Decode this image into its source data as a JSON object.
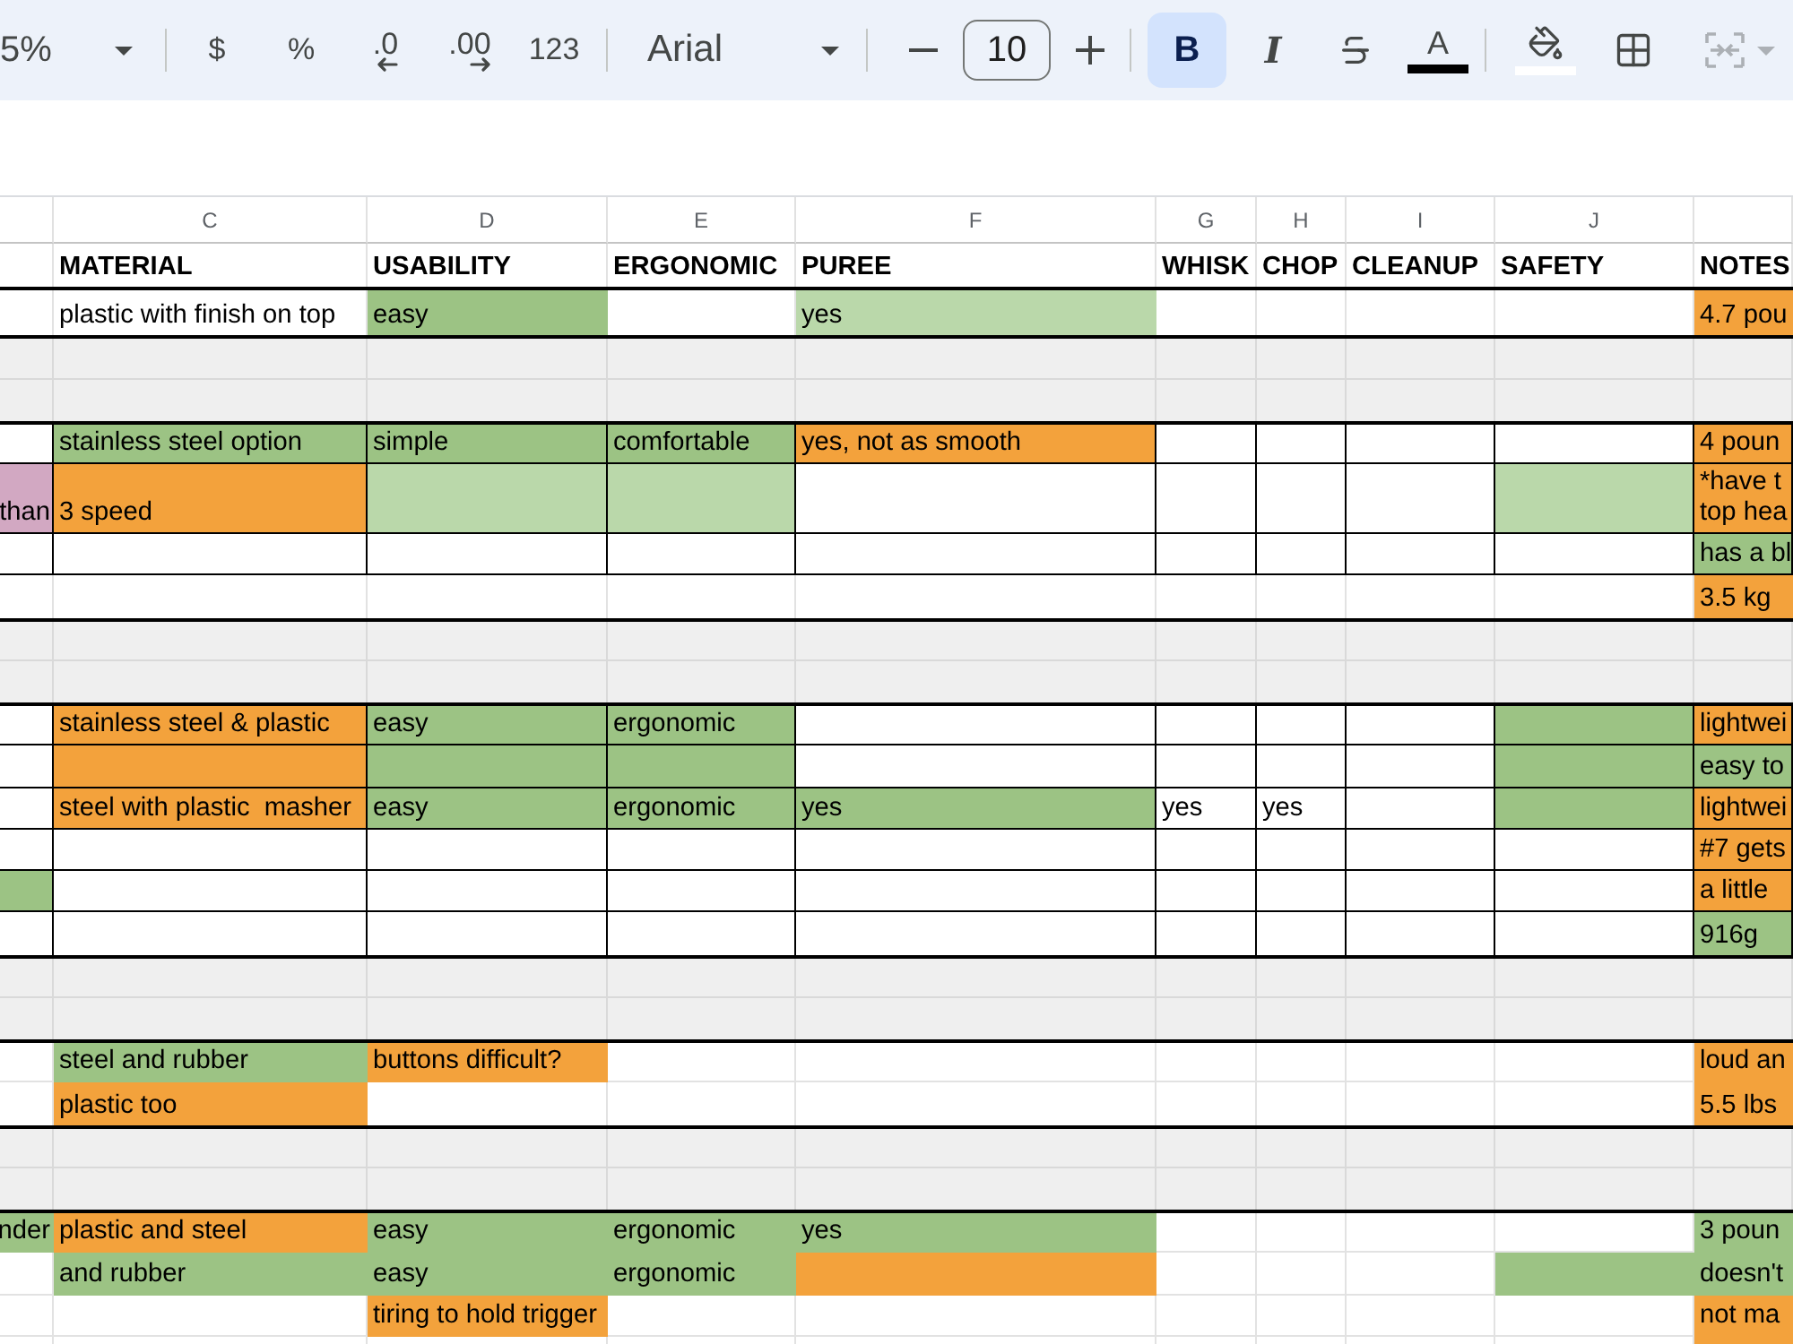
{
  "toolbar": {
    "groups": [
      [
        {
          "kind": "zoom",
          "label": "5%",
          "disabled": false
        }
      ],
      [
        {
          "kind": "text",
          "label": "$",
          "disabled": false
        },
        {
          "kind": "text",
          "label": "%",
          "disabled": false
        },
        {
          "kind": "decrease",
          "label": ".0",
          "disabled": false
        },
        {
          "kind": "increase",
          "label": ".00",
          "disabled": false
        },
        {
          "kind": "text",
          "label": "123",
          "disabled": false
        }
      ],
      [
        {
          "kind": "font",
          "label": "Arial",
          "disabled": false
        }
      ],
      [
        {
          "kind": "minus",
          "disabled": false
        },
        {
          "kind": "size",
          "value": "10",
          "disabled": false
        },
        {
          "kind": "plus",
          "disabled": false
        }
      ],
      [
        {
          "kind": "bold",
          "label": "B",
          "on": true,
          "disabled": false
        },
        {
          "kind": "italic",
          "label": "I",
          "on": false,
          "disabled": false
        },
        {
          "kind": "strike",
          "on": false,
          "disabled": false
        },
        {
          "kind": "textcolor",
          "label": "A",
          "color": "#000000",
          "disabled": false
        }
      ],
      [
        {
          "kind": "fill",
          "color": "#ffffff",
          "disabled": false
        },
        {
          "kind": "borders",
          "disabled": false
        },
        {
          "kind": "merge",
          "disabled": true
        }
      ]
    ]
  },
  "sheet": {
    "column_letters": [
      "C",
      "D",
      "E",
      "F",
      "G",
      "H",
      "I",
      "J"
    ],
    "rows": [
      {
        "kind": "header",
        "cells": [
          null,
          {
            "text": "MATERIAL"
          },
          {
            "text": "USABILITY"
          },
          {
            "text": "ERGONOMIC"
          },
          {
            "text": "PUREE"
          },
          {
            "text": "WHISK"
          },
          {
            "text": "CHOP"
          },
          {
            "text": "CLEANUP"
          },
          {
            "text": "SAFETY"
          },
          {
            "text": "NOTES"
          }
        ]
      },
      {
        "kind": "item",
        "bordered": false,
        "cells": [
          null,
          {
            "text": "plastic with finish on top"
          },
          {
            "text": "easy",
            "color": "#9cc384"
          },
          null,
          {
            "text": "yes",
            "color": "#bad8aa"
          },
          null,
          null,
          null,
          null,
          {
            "text": "4.7 pou",
            "color": "#f3a23c"
          }
        ]
      },
      {
        "kind": "gap"
      },
      {
        "kind": "gap"
      },
      {
        "kind": "item",
        "bordered": true,
        "cells": [
          null,
          {
            "text": "stainless steel option",
            "color": "#9cc384"
          },
          {
            "text": "simple",
            "color": "#9cc384"
          },
          {
            "text": "comfortable",
            "color": "#9cc384"
          },
          {
            "text": "yes, not as smooth",
            "color": "#f3a23c"
          },
          null,
          null,
          null,
          null,
          {
            "text": "4 poun",
            "color": "#f3a23c"
          }
        ]
      },
      {
        "kind": "item",
        "bordered": true,
        "cells": [
          {
            "text": "than",
            "color": "#d2a8c2"
          },
          {
            "text": "3 speed",
            "color": "#f3a23c"
          },
          {
            "color": "#bad8aa"
          },
          {
            "color": "#bad8aa"
          },
          null,
          null,
          null,
          null,
          {
            "color": "#bad8aa"
          },
          {
            "text": "*have t\ntop hea",
            "color": "#f3a23c"
          }
        ]
      },
      {
        "kind": "item",
        "bordered": true,
        "cells": [
          null,
          null,
          null,
          null,
          null,
          null,
          null,
          null,
          null,
          {
            "text": "has a bl",
            "color": "#9cc384"
          }
        ]
      },
      {
        "kind": "item",
        "bordered": false,
        "cells": [
          null,
          null,
          null,
          null,
          null,
          null,
          null,
          null,
          null,
          {
            "text": "3.5 kg",
            "color": "#f3a23c"
          }
        ]
      },
      {
        "kind": "gap"
      },
      {
        "kind": "gap"
      },
      {
        "kind": "item",
        "bordered": true,
        "cells": [
          null,
          {
            "text": "stainless steel & plastic",
            "color": "#f3a23c"
          },
          {
            "text": "easy",
            "color": "#9cc384"
          },
          {
            "text": "ergonomic",
            "color": "#9cc384"
          },
          null,
          null,
          null,
          null,
          {
            "color": "#9cc384"
          },
          {
            "text": "lightwei",
            "color": "#f3a23c"
          }
        ]
      },
      {
        "kind": "item",
        "bordered": true,
        "cells": [
          null,
          {
            "color": "#f3a23c"
          },
          {
            "color": "#9cc384"
          },
          {
            "color": "#9cc384"
          },
          null,
          null,
          null,
          null,
          {
            "color": "#9cc384"
          },
          {
            "text": "easy to",
            "color": "#9cc384"
          }
        ]
      },
      {
        "kind": "item",
        "bordered": true,
        "cells": [
          null,
          {
            "text": "steel with plastic  masher",
            "color": "#f3a23c"
          },
          {
            "text": "easy",
            "color": "#9cc384"
          },
          {
            "text": "ergonomic",
            "color": "#9cc384"
          },
          {
            "text": "yes",
            "color": "#9cc384"
          },
          {
            "text": "yes"
          },
          {
            "text": "yes"
          },
          null,
          {
            "color": "#9cc384"
          },
          {
            "text": "lightwei",
            "color": "#f3a23c"
          }
        ]
      },
      {
        "kind": "item",
        "bordered": true,
        "cells": [
          null,
          null,
          null,
          null,
          null,
          null,
          null,
          null,
          null,
          {
            "text": "#7 gets",
            "color": "#f3a23c"
          }
        ]
      },
      {
        "kind": "item",
        "bordered": true,
        "cells": [
          {
            "color": "#9cc384"
          },
          null,
          null,
          null,
          null,
          null,
          null,
          null,
          null,
          {
            "text": "a little",
            "color": "#f3a23c"
          }
        ]
      },
      {
        "kind": "item",
        "bordered": true,
        "cells": [
          null,
          null,
          null,
          null,
          null,
          null,
          null,
          null,
          null,
          {
            "text": "916g",
            "color": "#9cc384"
          }
        ]
      },
      {
        "kind": "gap"
      },
      {
        "kind": "gap"
      },
      {
        "kind": "item",
        "bordered": false,
        "cells": [
          null,
          {
            "text": "steel and rubber",
            "color": "#9cc384"
          },
          {
            "text": "buttons difficult?",
            "color": "#f3a23c"
          },
          null,
          null,
          null,
          null,
          null,
          null,
          {
            "text": "loud an",
            "color": "#f3a23c"
          }
        ]
      },
      {
        "kind": "item",
        "bordered": false,
        "cells": [
          null,
          {
            "text": "plastic too",
            "color": "#f3a23c"
          },
          null,
          null,
          null,
          null,
          null,
          null,
          null,
          {
            "text": "5.5 lbs",
            "color": "#f3a23c"
          }
        ]
      },
      {
        "kind": "gap"
      },
      {
        "kind": "gap"
      },
      {
        "kind": "item",
        "bordered": false,
        "cells": [
          {
            "text": "nder",
            "color": "#9cc384"
          },
          {
            "text": "plastic and steel",
            "color": "#f3a23c"
          },
          {
            "text": "easy",
            "color": "#9cc384"
          },
          {
            "text": "ergonomic",
            "color": "#9cc384"
          },
          {
            "text": "yes",
            "color": "#9cc384"
          },
          null,
          null,
          null,
          null,
          {
            "text": "3 poun",
            "color": "#9cc384"
          }
        ]
      },
      {
        "kind": "item",
        "bordered": false,
        "cells": [
          null,
          {
            "text": "and rubber",
            "color": "#9cc384"
          },
          {
            "text": "easy",
            "color": "#9cc384"
          },
          {
            "text": "ergonomic",
            "color": "#9cc384"
          },
          {
            "color": "#f3a23c"
          },
          null,
          null,
          null,
          {
            "color": "#9cc384"
          },
          {
            "text": "doesn't",
            "color": "#9cc384"
          }
        ]
      },
      {
        "kind": "item",
        "bordered": false,
        "cells": [
          null,
          null,
          {
            "text": "tiring to hold trigger",
            "color": "#f3a23c"
          },
          null,
          null,
          null,
          null,
          null,
          null,
          {
            "text": "not ma",
            "color": "#f3a23c"
          }
        ]
      },
      {
        "kind": "item",
        "bordered": false,
        "cells": [
          null,
          null,
          null,
          null,
          null,
          null,
          null,
          null,
          null,
          {
            "color": "#f3a23c"
          }
        ]
      }
    ]
  }
}
